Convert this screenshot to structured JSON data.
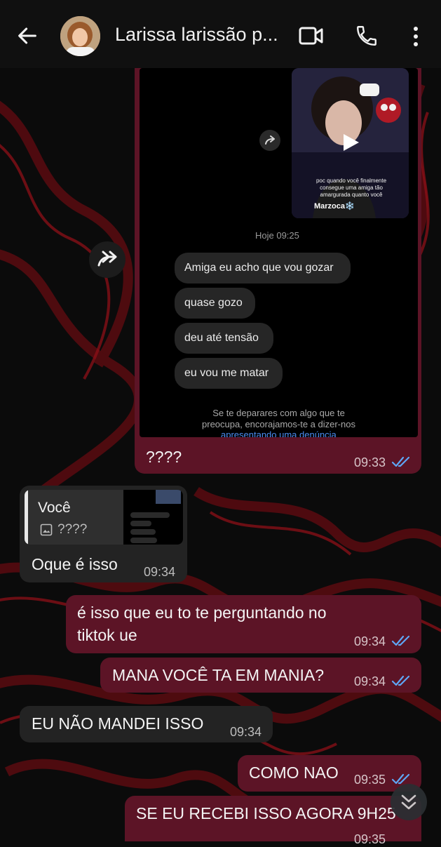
{
  "header": {
    "contact_name": "Larissa larissão p...",
    "back_icon": "arrow-left-icon",
    "video_icon": "video-call-icon",
    "call_icon": "phone-icon",
    "menu_icon": "more-vertical-icon"
  },
  "colors": {
    "outgoing_bubble": "#5c1426",
    "incoming_bubble": "#232323",
    "read_ticks": "#5ea6f5",
    "header": "#101010"
  },
  "forwarded_screenshot": {
    "video_caption": "poc quando você finalmente consegue uma amiga tão amargurada quanto você",
    "video_author": "Marzoca❄️",
    "timestamp": "Hoje 09:25",
    "messages": [
      "Amiga eu acho que vou gozar",
      "quase gozo",
      "deu até tensão",
      "eu vou me matar"
    ],
    "notice": [
      "Se te deparares com algo que te",
      "preocupa, encorajamos-te a dizer-nos"
    ],
    "notice_link": "apresentando uma denúncia"
  },
  "messages": [
    {
      "text": "????",
      "time": "09:33"
    },
    {
      "reply_author": "Você",
      "reply_preview": "????",
      "text": "Oque é isso",
      "time": "09:34"
    },
    {
      "line1": "é isso que eu to te perguntando no",
      "line2": "tiktok ue",
      "time": "09:34"
    },
    {
      "text": "MANA VOCÊ TA EM MANIA?",
      "time": "09:34"
    },
    {
      "text": "EU NÃO MANDEI ISSO",
      "time": "09:34"
    },
    {
      "text": "COMO NAO",
      "time": "09:35"
    },
    {
      "text": "SE EU RECEBI ISSO AGORA 9H25",
      "time": "09:35"
    }
  ]
}
